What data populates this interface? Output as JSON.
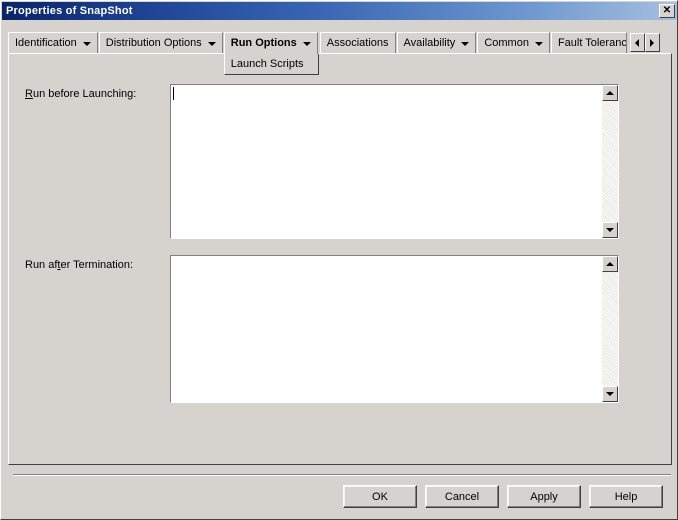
{
  "window": {
    "title": "Properties of SnapShot",
    "close_label": "✕"
  },
  "tabs": [
    {
      "label": "Identification",
      "has_dropdown": true,
      "active": false
    },
    {
      "label": "Distribution Options",
      "has_dropdown": true,
      "active": false
    },
    {
      "label": "Run Options",
      "has_dropdown": true,
      "active": true
    },
    {
      "label": "Associations",
      "has_dropdown": false,
      "active": false
    },
    {
      "label": "Availability",
      "has_dropdown": true,
      "active": false
    },
    {
      "label": "Common",
      "has_dropdown": true,
      "active": false
    },
    {
      "label": "Fault Tolerance",
      "has_dropdown": false,
      "active": false
    }
  ],
  "tab_labels": {
    "identification": "Identification",
    "distribution_options": "Distribution Options",
    "run_options": "Run Options",
    "associations": "Associations",
    "availability": "Availability",
    "common": "Common",
    "fault_tolerance": "Fault Tolerance"
  },
  "subtab": {
    "label": "Launch Scripts"
  },
  "tab_scroll": {
    "left_label": "◀",
    "right_label": "▶"
  },
  "fields": {
    "run_before": {
      "label_prefix": "",
      "label_mnemonic": "R",
      "label_rest": "un before Launching:",
      "value": "",
      "focused": true
    },
    "run_after": {
      "label_prefix": "Run af",
      "label_mnemonic": "t",
      "label_rest": "er Termination:",
      "value": "",
      "focused": false
    }
  },
  "buttons": {
    "ok": "OK",
    "cancel": "Cancel",
    "apply": "Apply",
    "help": "Help"
  },
  "colors": {
    "face": "#d6d3ce",
    "titlebar_start": "#0a246a",
    "titlebar_end": "#a6c0e0",
    "field_bg": "#ffffff",
    "text": "#000000"
  }
}
